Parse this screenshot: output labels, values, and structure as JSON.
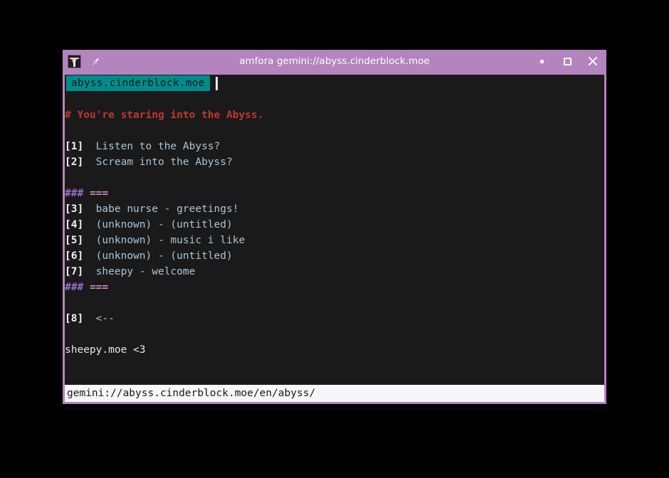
{
  "window": {
    "title": "amfora gemini://abyss.cinderblock.moe",
    "app_icon": "amfora-icon",
    "pin_icon": "pin-icon",
    "controls": {
      "minimize_label": "▪",
      "maximize_label": "□",
      "close_label": "✕"
    },
    "colors": {
      "titlebar": "#b484be",
      "border": "#b484be",
      "terminal_bg": "#1a1a1a",
      "tab_active_bg": "#008c8c",
      "heading": "#c0392b",
      "link_text": "#a9c4d8",
      "subheading_hash": "#9b6fd4",
      "subheading_eq": "#d98ac6",
      "statusbar_bg": "#f7f6f8"
    }
  },
  "tabbar": {
    "active_tab_label": "abyss.cinderblock.moe"
  },
  "page": {
    "lines": [
      {
        "type": "blank",
        "text": ""
      },
      {
        "type": "heading",
        "text": "# You're staring into the Abyss."
      },
      {
        "type": "blank",
        "text": ""
      },
      {
        "type": "link",
        "num": "[1]",
        "text": "Listen to the Abyss?"
      },
      {
        "type": "link",
        "num": "[2]",
        "text": "Scream into the Abyss?"
      },
      {
        "type": "blank",
        "text": ""
      },
      {
        "type": "subheading",
        "hash": "###",
        "eq": "==="
      },
      {
        "type": "link",
        "num": "[3]",
        "text": "babe nurse - greetings!"
      },
      {
        "type": "link",
        "num": "[4]",
        "text": "(unknown) - (untitled)"
      },
      {
        "type": "link",
        "num": "[5]",
        "text": "(unknown) - music i like"
      },
      {
        "type": "link",
        "num": "[6]",
        "text": "(unknown) - (untitled)"
      },
      {
        "type": "link",
        "num": "[7]",
        "text": "sheepy - welcome"
      },
      {
        "type": "subheading",
        "hash": "###",
        "eq": "==="
      },
      {
        "type": "blank",
        "text": ""
      },
      {
        "type": "link",
        "num": "[8]",
        "text": "<--"
      },
      {
        "type": "blank",
        "text": ""
      },
      {
        "type": "plain",
        "text": "sheepy.moe <3"
      }
    ]
  },
  "statusbar": {
    "url": "gemini://abyss.cinderblock.moe/en/abyss/"
  }
}
